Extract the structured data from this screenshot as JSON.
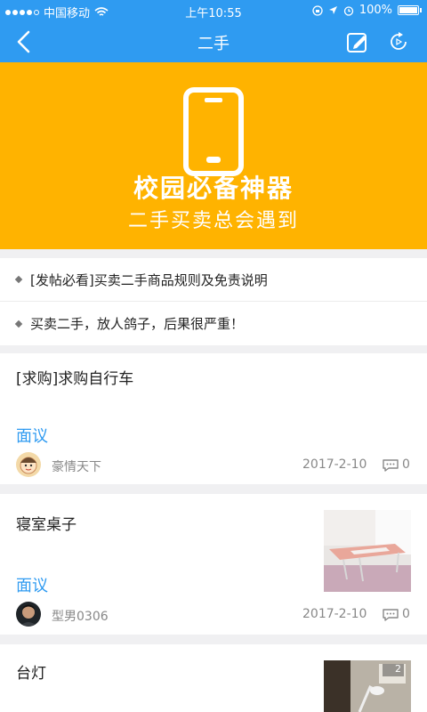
{
  "statusbar": {
    "carrier": "中国移动",
    "time": "上午10:55",
    "battery": "100%"
  },
  "nav": {
    "title": "二手",
    "back_icon": "back-arrow-icon",
    "edit_icon": "edit-icon",
    "refresh_icon": "refresh-icon"
  },
  "banner": {
    "title": "校园必备神器",
    "subtitle": "二手买卖总会遇到"
  },
  "notices": [
    {
      "text": "[发帖必看]买卖二手商品规则及免责说明"
    },
    {
      "text": "买卖二手，放人鸽子，后果很严重！"
    }
  ],
  "posts": [
    {
      "title": "[求购]求购自行车",
      "price": "面议",
      "user": "豪情天下",
      "date": "2017-2-10",
      "comments": "0"
    },
    {
      "title": "寝室桌子",
      "price": "面议",
      "user": "型男0306",
      "date": "2017-2-10",
      "comments": "0"
    },
    {
      "title": "台灯",
      "thumb_badge": "2"
    }
  ]
}
